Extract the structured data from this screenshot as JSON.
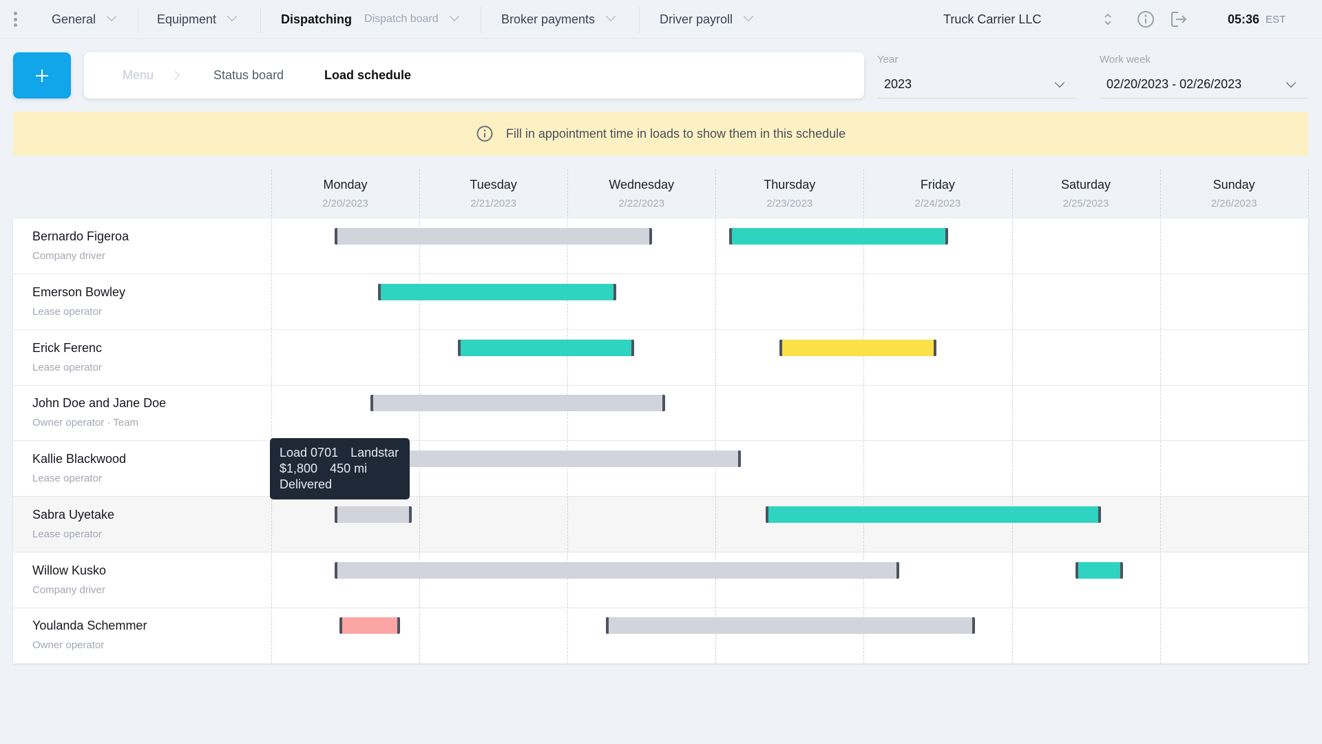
{
  "topnav": {
    "items": [
      {
        "label": "General"
      },
      {
        "label": "Equipment"
      },
      {
        "label": "Dispatching",
        "sub": "Dispatch board",
        "active": true
      },
      {
        "label": "Broker payments"
      },
      {
        "label": "Driver payroll"
      }
    ],
    "company": "Truck Carrier LLC",
    "clock": {
      "time": "05:36",
      "tz": "EST"
    },
    "icons": [
      "kebab-menu-icon",
      "sort-updown-icon",
      "info-icon",
      "logout-icon"
    ]
  },
  "breadcrumb": {
    "items": [
      "Menu",
      "Status board",
      "Load schedule"
    ]
  },
  "filters": {
    "year": {
      "label": "Year",
      "value": "2023"
    },
    "work_week": {
      "label": "Work week",
      "value": "02/20/2023 - 02/26/2023"
    }
  },
  "banner": {
    "text": "Fill in appointment time in loads to show them in this schedule",
    "icon": "info-icon"
  },
  "colors": {
    "accent": "#11a5e9",
    "bar_gray": "#d1d4db",
    "bar_teal": "#2fd4c0",
    "bar_yellow": "#fce047",
    "bar_red": "#fca5a5",
    "bar_cap": "#4d5360",
    "banner_bg": "#fdf1c4",
    "tooltip_bg": "#1f2836"
  },
  "days": [
    {
      "name": "Monday",
      "date": "2/20/2023"
    },
    {
      "name": "Tuesday",
      "date": "2/21/2023"
    },
    {
      "name": "Wednesday",
      "date": "2/22/2023"
    },
    {
      "name": "Thursday",
      "date": "2/23/2023"
    },
    {
      "name": "Friday",
      "date": "2/24/2023"
    },
    {
      "name": "Saturday",
      "date": "2/25/2023"
    },
    {
      "name": "Sunday",
      "date": "2/26/2023"
    }
  ],
  "drivers": [
    {
      "name": "Bernardo Figeroa",
      "type": "Company driver",
      "loads": [
        {
          "start_day": 0.43,
          "end_day": 2.57,
          "status": "gray"
        },
        {
          "start_day": 3.09,
          "end_day": 4.57,
          "status": "teal"
        }
      ]
    },
    {
      "name": "Emerson Bowley",
      "type": "Lease operator",
      "loads": [
        {
          "start_day": 0.72,
          "end_day": 2.33,
          "status": "teal"
        }
      ]
    },
    {
      "name": "Erick Ferenc",
      "type": "Lease operator",
      "loads": [
        {
          "start_day": 1.26,
          "end_day": 2.45,
          "status": "teal"
        },
        {
          "start_day": 3.43,
          "end_day": 4.49,
          "status": "yellow"
        }
      ]
    },
    {
      "name": "John Doe and Jane Doe",
      "type": "Owner operator  ·  Team",
      "loads": [
        {
          "start_day": 0.67,
          "end_day": 2.66,
          "status": "gray"
        }
      ]
    },
    {
      "name": "Kallie Blackwood",
      "type": "Lease operator",
      "loads": [
        {
          "start_day": 0.43,
          "end_day": 3.17,
          "status": "gray"
        }
      ]
    },
    {
      "name": "Sabra Uyetake",
      "type": "Lease operator",
      "highlighted": true,
      "loads": [
        {
          "start_day": 0.43,
          "end_day": 0.95,
          "status": "gray"
        },
        {
          "start_day": 3.34,
          "end_day": 5.6,
          "status": "teal"
        }
      ]
    },
    {
      "name": "Willow Kusko",
      "type": "Company driver",
      "loads": [
        {
          "start_day": 0.43,
          "end_day": 4.24,
          "status": "gray"
        },
        {
          "start_day": 5.43,
          "end_day": 5.75,
          "status": "teal"
        }
      ]
    },
    {
      "name": "Youlanda Schemmer",
      "type": "Owner operator",
      "loads": [
        {
          "start_day": 0.46,
          "end_day": 0.87,
          "status": "red"
        },
        {
          "start_day": 2.26,
          "end_day": 4.75,
          "status": "gray"
        }
      ]
    }
  ],
  "tooltip": {
    "load": "Load 0701",
    "broker": "Landstar",
    "amount": "$1,800",
    "distance": "450 mi",
    "status": "Delivered"
  }
}
